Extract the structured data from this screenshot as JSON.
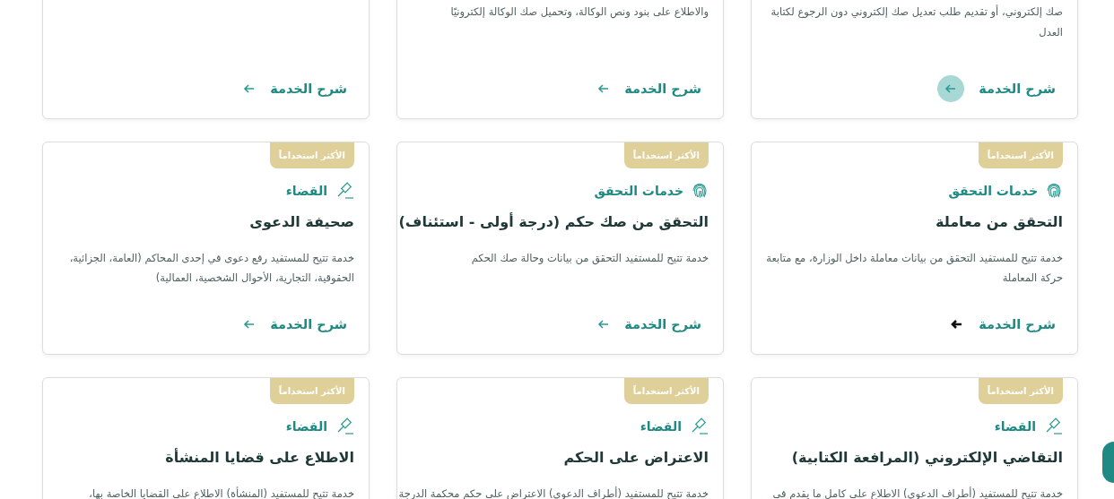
{
  "cards": [
    {
      "description": "صك إلكتروني، أو تقديم طلب تعديل صك إلكتروني دون الرجوع لكتابة العدل",
      "link": {
        "label": "شرح الخدمة",
        "kind": "circle"
      }
    },
    {
      "description": "والاطلاع على بنود ونص الوكالة، وتحميل صك الوكالة إلكترونيًا",
      "link": {
        "label": "شرح الخدمة",
        "kind": "plain"
      }
    },
    {
      "link": {
        "label": "شرح الخدمة",
        "kind": "plain"
      }
    },
    {
      "badge": "الأكثر استخداماً",
      "category": {
        "label": "خدمات التحقق",
        "kind": "verification"
      },
      "title": "التحقق من معاملة",
      "description": "خدمة تتيح للمستفيد التحقق من بيانات معاملة داخل الوزارة، مع متابعة حركة المعاملة",
      "link": {
        "label": "شرح الخدمة",
        "kind": "dark"
      }
    },
    {
      "badge": "الأكثر استخداماً",
      "category": {
        "label": "خدمات التحقق",
        "kind": "verification"
      },
      "title": "التحقق من صك حكم (درجة أولى - استئناف)",
      "description": "خدمة تتيح للمستفيد التحقق من بيانات وحالة صك الحكم",
      "link": {
        "label": "شرح الخدمة",
        "kind": "plain"
      }
    },
    {
      "badge": "الأكثر استخداماً",
      "category": {
        "label": "القضاء",
        "kind": "judiciary"
      },
      "title": "صحيفة الدعوى",
      "description": "خدمة تتيح للمستفيد رفع دعوى في إحدى المحاكم (العامة، الجزائية، الحقوقية، التجارية، الأحوال الشخصية، العمالية)",
      "link": {
        "label": "شرح الخدمة",
        "kind": "plain"
      }
    },
    {
      "badge": "الأكثر استخداماً",
      "category": {
        "label": "القضاء",
        "kind": "judiciary"
      },
      "title": "التقاضي الإلكتروني (المرافعة الكتابية)",
      "description": "خدمة تتيح للمستفيد (أطراف الدعوى) الاطلاع على كامل ما يقدم في"
    },
    {
      "badge": "الأكثر استخداماً",
      "category": {
        "label": "القضاء",
        "kind": "judiciary"
      },
      "title": "الاعتراض على الحكم",
      "description": "خدمة تتيح للمستفيد (أطراف الدعوى) الاعتراض على حكم محكمة الدرجة"
    },
    {
      "badge": "الأكثر استخداماً",
      "category": {
        "label": "القضاء",
        "kind": "judiciary"
      },
      "title": "الاطلاع على قضايا المنشأة",
      "description": "خدمة تتيح للمستفيد (المنشأة) الاطلاع على القضايا الخاصة بها،"
    }
  ]
}
